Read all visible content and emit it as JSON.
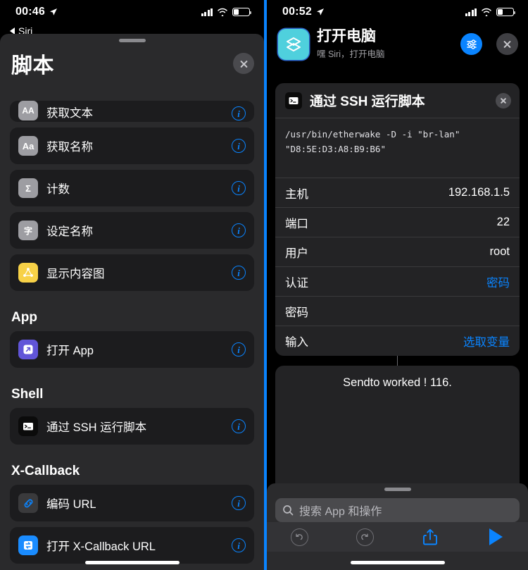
{
  "left": {
    "status": {
      "time": "00:46",
      "location_icon": "location-arrow-icon",
      "signal_icon": "cellular-signal-icon",
      "wifi_icon": "wifi-icon",
      "battery_icon": "battery-low-icon"
    },
    "back": {
      "label": "Siri",
      "icon": "back-triangle-icon"
    },
    "sheet": {
      "title": "脚本",
      "close_icon": "close-icon",
      "grabber": "sheet-grabber"
    },
    "sections": [
      {
        "title": "",
        "items": [
          {
            "label": "获取文本",
            "icon": "get-text-icon",
            "icon_style": "gray",
            "glyph": "",
            "clipped": true
          },
          {
            "label": "获取名称",
            "icon": "get-name-icon",
            "icon_style": "gray",
            "glyph": "Aa"
          },
          {
            "label": "计数",
            "icon": "count-icon",
            "icon_style": "gray",
            "glyph": "Σ"
          },
          {
            "label": "设定名称",
            "icon": "set-name-icon",
            "icon_style": "gray",
            "glyph": "字"
          },
          {
            "label": "显示内容图",
            "icon": "show-content-graph-icon",
            "icon_style": "yellow",
            "glyph": ""
          }
        ]
      },
      {
        "title": "App",
        "items": [
          {
            "label": "打开 App",
            "icon": "open-app-icon",
            "icon_style": "purple",
            "glyph": ""
          }
        ]
      },
      {
        "title": "Shell",
        "items": [
          {
            "label": "通过 SSH 运行脚本",
            "icon": "terminal-icon",
            "icon_style": "black",
            "glyph": ""
          }
        ]
      },
      {
        "title": "X-Callback",
        "items": [
          {
            "label": "编码 URL",
            "icon": "link-icon",
            "icon_style": "darkgray",
            "glyph": ""
          },
          {
            "label": "打开 X-Callback URL",
            "icon": "x-callback-icon",
            "icon_style": "blue",
            "glyph": ""
          }
        ]
      }
    ],
    "info_label": "i"
  },
  "right": {
    "status": {
      "time": "00:52",
      "location_icon": "location-arrow-icon",
      "signal_icon": "cellular-signal-icon",
      "wifi_icon": "wifi-icon",
      "battery_icon": "battery-low-icon"
    },
    "header": {
      "app_icon": "shortcuts-layers-icon",
      "title": "打开电脑",
      "subtitle": "嘿 Siri，打开电脑",
      "settings_icon": "sliders-icon",
      "close_icon": "close-icon"
    },
    "action_card": {
      "icon": "terminal-icon",
      "title": "通过 SSH 运行脚本",
      "close_icon": "close-icon",
      "script": "/usr/bin/etherwake -D -i \"br-lan\"\n\"D8:5E:D3:A8:B9:B6\"",
      "params": [
        {
          "key": "主机",
          "value": "192.168.1.5",
          "is_link": false
        },
        {
          "key": "端口",
          "value": "22",
          "is_link": false
        },
        {
          "key": "用户",
          "value": "root",
          "is_link": false
        },
        {
          "key": "认证",
          "value": "密码",
          "is_link": true
        },
        {
          "key": "密码",
          "value": "",
          "is_link": false
        },
        {
          "key": "输入",
          "value": "选取变量",
          "is_link": true
        }
      ]
    },
    "output_card": {
      "text": "Sendto worked ! 116."
    },
    "search": {
      "placeholder": "搜索 App 和操作",
      "icon": "search-icon"
    },
    "toolbar": {
      "undo_icon": "undo-icon",
      "redo_icon": "redo-icon",
      "share_icon": "share-icon",
      "play_icon": "play-icon"
    }
  },
  "colors": {
    "accent_blue": "#0a84ff",
    "panel_bg": "#2a2a2c",
    "card_bg": "#232325",
    "row_bg": "#1c1c1e",
    "app_icon_cyan": "#4fd0dd"
  }
}
